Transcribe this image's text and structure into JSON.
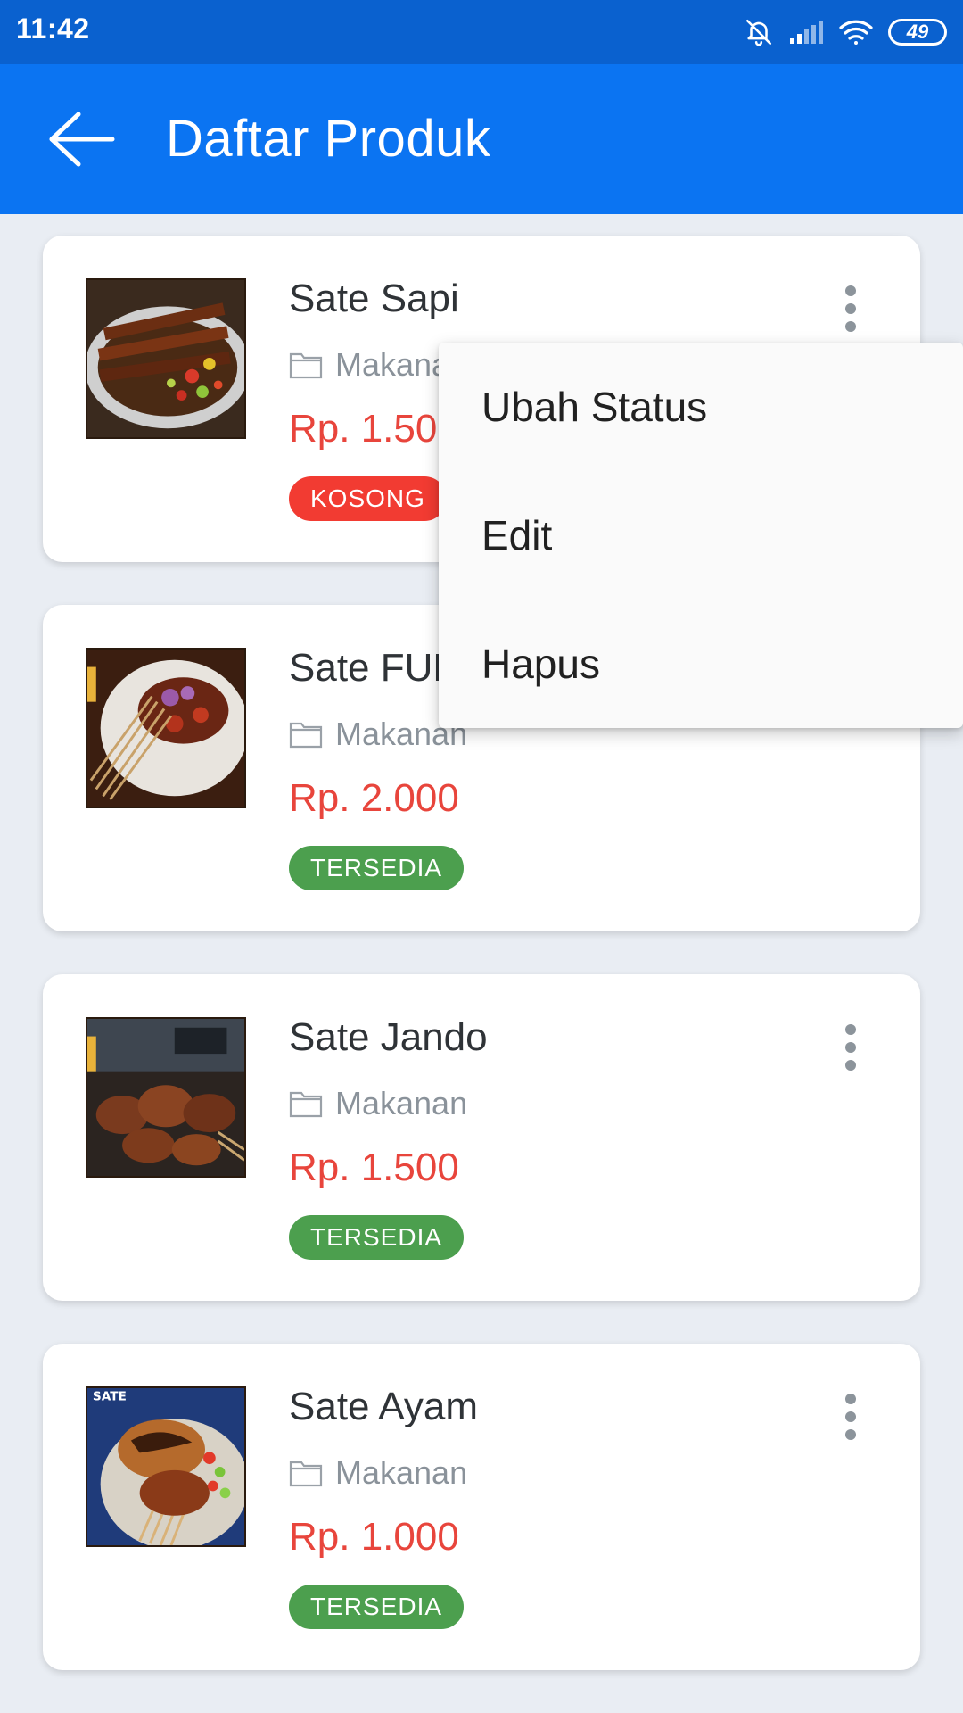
{
  "status_bar": {
    "time": "11:42",
    "battery": "49",
    "icons": [
      "bell-off-icon",
      "signal-icon",
      "wifi-icon",
      "battery-icon"
    ]
  },
  "app_bar": {
    "title": "Daftar Produk",
    "back_icon": "arrow-back-icon"
  },
  "colors": {
    "status_bar": "#0A61CF",
    "app_bar": "#0B74F2",
    "price": "#E8453C",
    "badge_kosong": "#F23B32",
    "badge_tersedia": "#4C9F4E",
    "background": "#E9EDF3"
  },
  "products": [
    {
      "name": "Sate Sapi",
      "category": "Makanan",
      "price": "Rp. 1.500",
      "status": "KOSONG"
    },
    {
      "name": "Sate FULL",
      "category": "Makanan",
      "price": "Rp. 2.000",
      "status": "TERSEDIA"
    },
    {
      "name": "Sate Jando",
      "category": "Makanan",
      "price": "Rp. 1.500",
      "status": "TERSEDIA"
    },
    {
      "name": "Sate Ayam",
      "category": "Makanan",
      "price": "Rp. 1.000",
      "status": "TERSEDIA"
    }
  ],
  "popup_menu": {
    "items": [
      "Ubah Status",
      "Edit",
      "Hapus"
    ]
  }
}
